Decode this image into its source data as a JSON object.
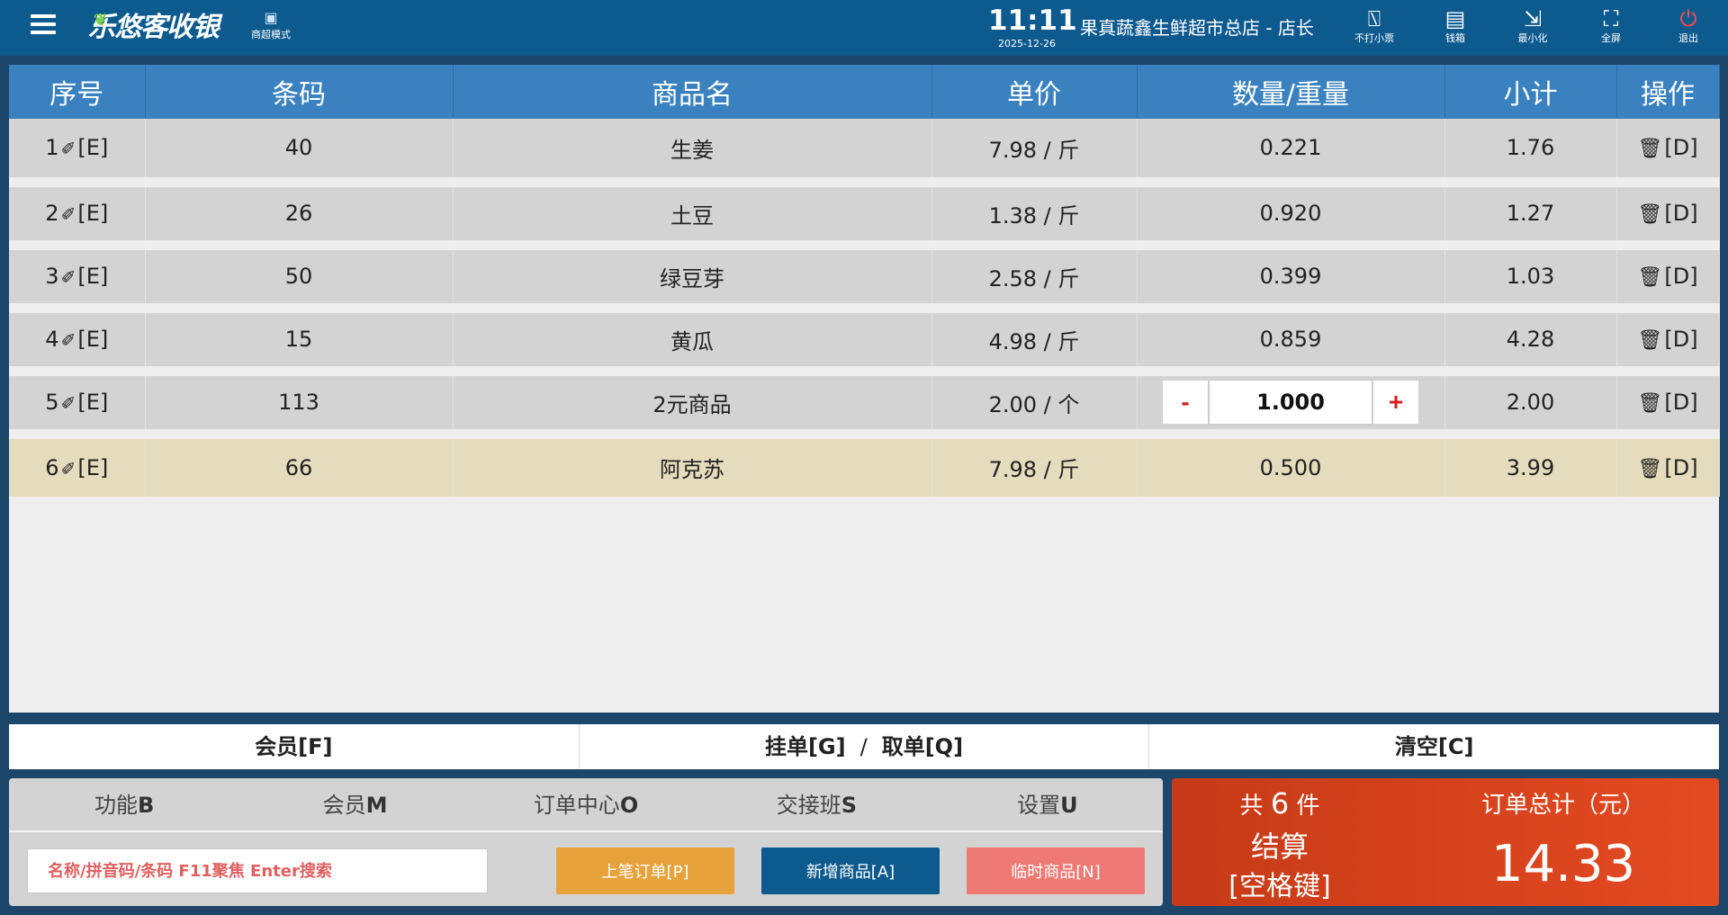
{
  "topbar": {
    "logo_text": "乐悠客收银",
    "mode_label": "商超模式",
    "time": "11:11",
    "date": "2025-12-26",
    "store": "果真蔬鑫生鲜超市总店 - 店长",
    "buttons": {
      "no_print": "不打小票",
      "cash_drawer": "钱箱",
      "minimize": "最小化",
      "fullscreen": "全屏",
      "exit": "退出"
    },
    "icons": [
      "menu-icon",
      "supermarket-mode-icon",
      "no-receipt-icon",
      "cash-drawer-icon",
      "minimize-icon",
      "fullscreen-icon",
      "power-icon"
    ]
  },
  "table": {
    "columns": [
      "序号",
      "条码",
      "商品名",
      "单价",
      "数量/重量",
      "小计",
      "操作"
    ],
    "edit_suffix": "[E]",
    "delete_label": "[D]",
    "rows": [
      {
        "seq": "1",
        "barcode": "40",
        "name": "生姜",
        "price": "7.98 / 斤",
        "qty": "0.221",
        "subtotal": "1.76"
      },
      {
        "seq": "2",
        "barcode": "26",
        "name": "土豆",
        "price": "1.38 / 斤",
        "qty": "0.920",
        "subtotal": "1.27"
      },
      {
        "seq": "3",
        "barcode": "50",
        "name": "绿豆芽",
        "price": "2.58 / 斤",
        "qty": "0.399",
        "subtotal": "1.03"
      },
      {
        "seq": "4",
        "barcode": "15",
        "name": "黄瓜",
        "price": "4.98 / 斤",
        "qty": "0.859",
        "subtotal": "4.28"
      },
      {
        "seq": "5",
        "barcode": "113",
        "name": "2元商品",
        "price": "2.00 / 个",
        "qty": "1.000",
        "subtotal": "2.00"
      },
      {
        "seq": "6",
        "barcode": "66",
        "name": "阿克苏",
        "price": "7.98 / 斤",
        "qty": "0.500",
        "subtotal": "3.99"
      }
    ],
    "qty_minus": "-",
    "qty_plus": "+"
  },
  "actions": {
    "member": "会员[F]",
    "hold_order": "挂单[G]",
    "separator": "/",
    "retrieve_order": "取单[Q]",
    "clear": "清空[C]"
  },
  "bottom": {
    "tabs": [
      {
        "label": "功能",
        "key": "B"
      },
      {
        "label": "会员",
        "key": "M"
      },
      {
        "label": "订单中心",
        "key": "O"
      },
      {
        "label": "交接班",
        "key": "S"
      },
      {
        "label": "设置",
        "key": "U"
      }
    ],
    "search_placeholder": "名称/拼音码/条码 F11聚焦 Enter搜索",
    "last_order": "上笔订单[P]",
    "new_product": "新增商品[A]",
    "temp_product": "临时商品[N]"
  },
  "checkout": {
    "count_prefix": "共",
    "count": "6",
    "count_suffix": "件",
    "settle": "结算",
    "settle_key": "[空格键]",
    "total_label": "订单总计（元）",
    "total": "14.33"
  },
  "colors": {
    "topbar": "#0d5a8f",
    "table_header": "#3a82bf",
    "selected_row": "#e4dcbc",
    "checkout": "#e04521",
    "last_order_btn": "#e8a23c",
    "new_product_btn": "#0c5a8e",
    "temp_product_btn": "#ef7a74"
  }
}
